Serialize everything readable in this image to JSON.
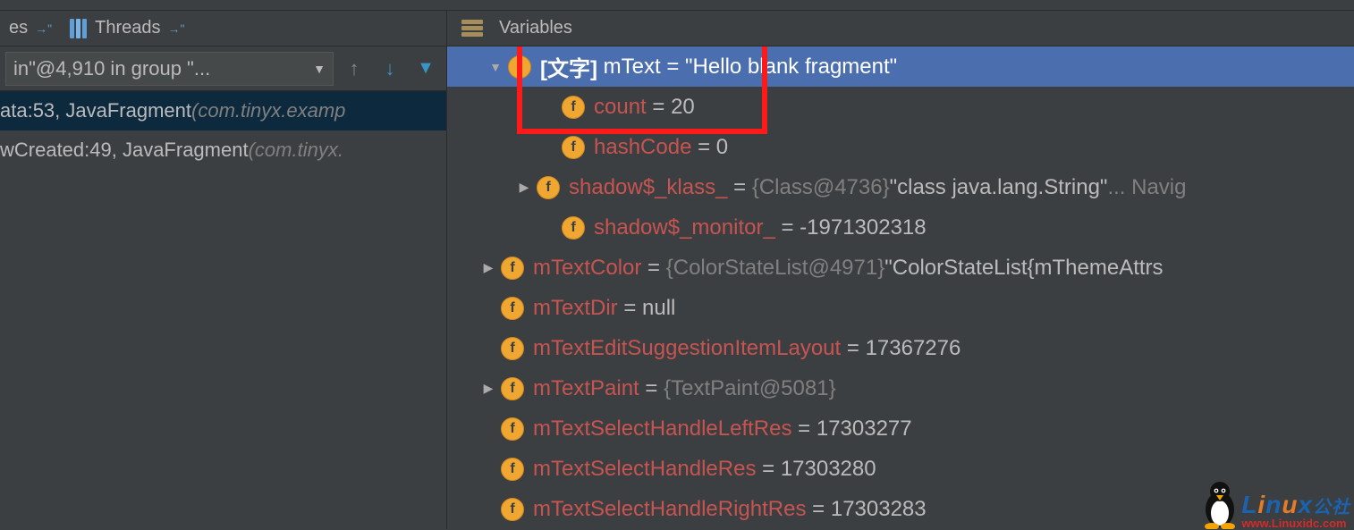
{
  "leftTabs": {
    "tab0": "es",
    "tab1": "Threads"
  },
  "combo": "in\"@4,910 in group \"...",
  "stack": [
    {
      "line": "ata:53, JavaFragment ",
      "pkg": "(com.tinyx.examp"
    },
    {
      "line": "wCreated:49, JavaFragment ",
      "pkg": "(com.tinyx."
    }
  ],
  "rightHeader": "Variables",
  "vars": {
    "mText": {
      "annot": "[文字]",
      "name": "mText",
      "val": "\"Hello blank fragment\""
    },
    "count": {
      "name": "count",
      "val": "20"
    },
    "hashCode": {
      "name": "hashCode",
      "val": "0"
    },
    "shadowKlass": {
      "name": "shadow$_klass_",
      "ref": "{Class@4736}",
      "val": " \"class java.lang.String\"",
      "extra": " ... Navig"
    },
    "shadowMon": {
      "name": "shadow$_monitor_",
      "val": "-1971302318"
    },
    "mTextColor": {
      "name": "mTextColor",
      "ref": "{ColorStateList@4971}",
      "val": " \"ColorStateList{mThemeAttrs"
    },
    "mTextDir": {
      "name": "mTextDir",
      "val": "null"
    },
    "mTextEditSug": {
      "name": "mTextEditSuggestionItemLayout",
      "val": "17367276"
    },
    "mTextPaint": {
      "name": "mTextPaint",
      "ref": "{TextPaint@5081}"
    },
    "mSelHandleLeft": {
      "name": "mTextSelectHandleLeftRes",
      "val": "17303277"
    },
    "mSelHandle": {
      "name": "mTextSelectHandleRes",
      "val": "17303280"
    },
    "mSelHandleRight": {
      "name": "mTextSelectHandleRightRes",
      "val": "17303283"
    }
  },
  "watermark": {
    "title1": "Linux",
    "cn": "公社",
    "url": "www.Linuxidc.com"
  }
}
